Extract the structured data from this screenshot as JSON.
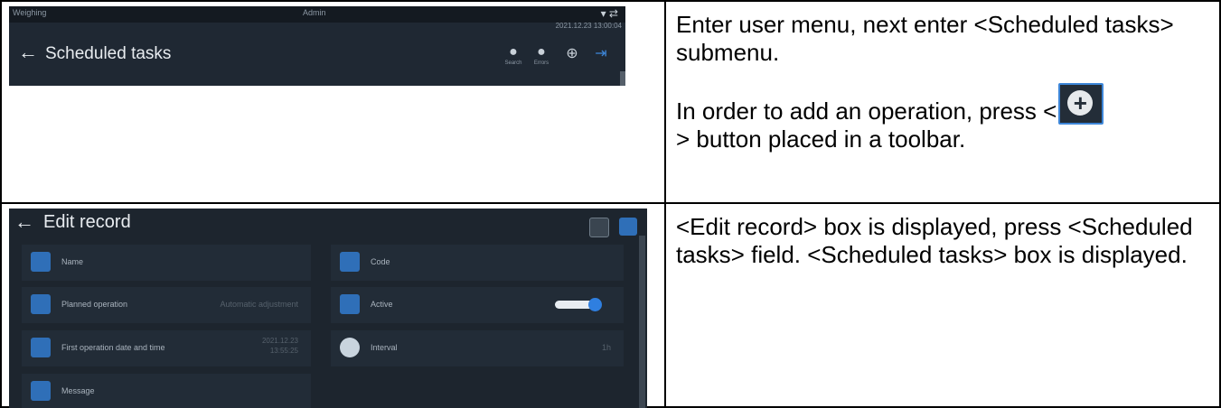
{
  "top_row": {
    "text_line1": "Enter user menu, next enter <Scheduled tasks> submenu.",
    "text_line2_part1": "In order to add an operation, press <",
    "text_line2_part2": "> button placed in a toolbar.",
    "inline_icon": "plus-circle-icon",
    "screenshot": {
      "status_left": "Weighing",
      "status_mid": "Admin",
      "status_time": "2021.12.23  13:00:04",
      "back_icon": "back-arrow-icon",
      "title": "Scheduled tasks",
      "toolbar": [
        {
          "icon": "user-icon",
          "label": "Search"
        },
        {
          "icon": "user-icon",
          "label": "Errors"
        },
        {
          "icon": "add-icon",
          "label": ""
        },
        {
          "icon": "exit-icon",
          "label": ""
        }
      ]
    }
  },
  "bottom_row": {
    "text": "<Edit record> box is displayed, press <Scheduled tasks> field. <Scheduled tasks> box is displayed.",
    "screenshot": {
      "title": "Edit record",
      "back_icon": "back-arrow-icon",
      "fields": {
        "name": {
          "label": "Name",
          "value": ""
        },
        "code": {
          "label": "Code",
          "value": ""
        },
        "planned_operation": {
          "label": "Planned operation",
          "value": "Automatic adjustment"
        },
        "active": {
          "label": "Active",
          "value": "on"
        },
        "first_operation": {
          "label": "First operation date and time",
          "value_line1": "2021.12.23",
          "value_line2": "13:55:25"
        },
        "interval": {
          "label": "Interval",
          "value": "1h"
        },
        "message": {
          "label": "Message",
          "value": ""
        }
      }
    }
  },
  "colors": {
    "ui_dark": "#1f2833",
    "accent_blue": "#2f7fe0",
    "border": "#000000"
  }
}
